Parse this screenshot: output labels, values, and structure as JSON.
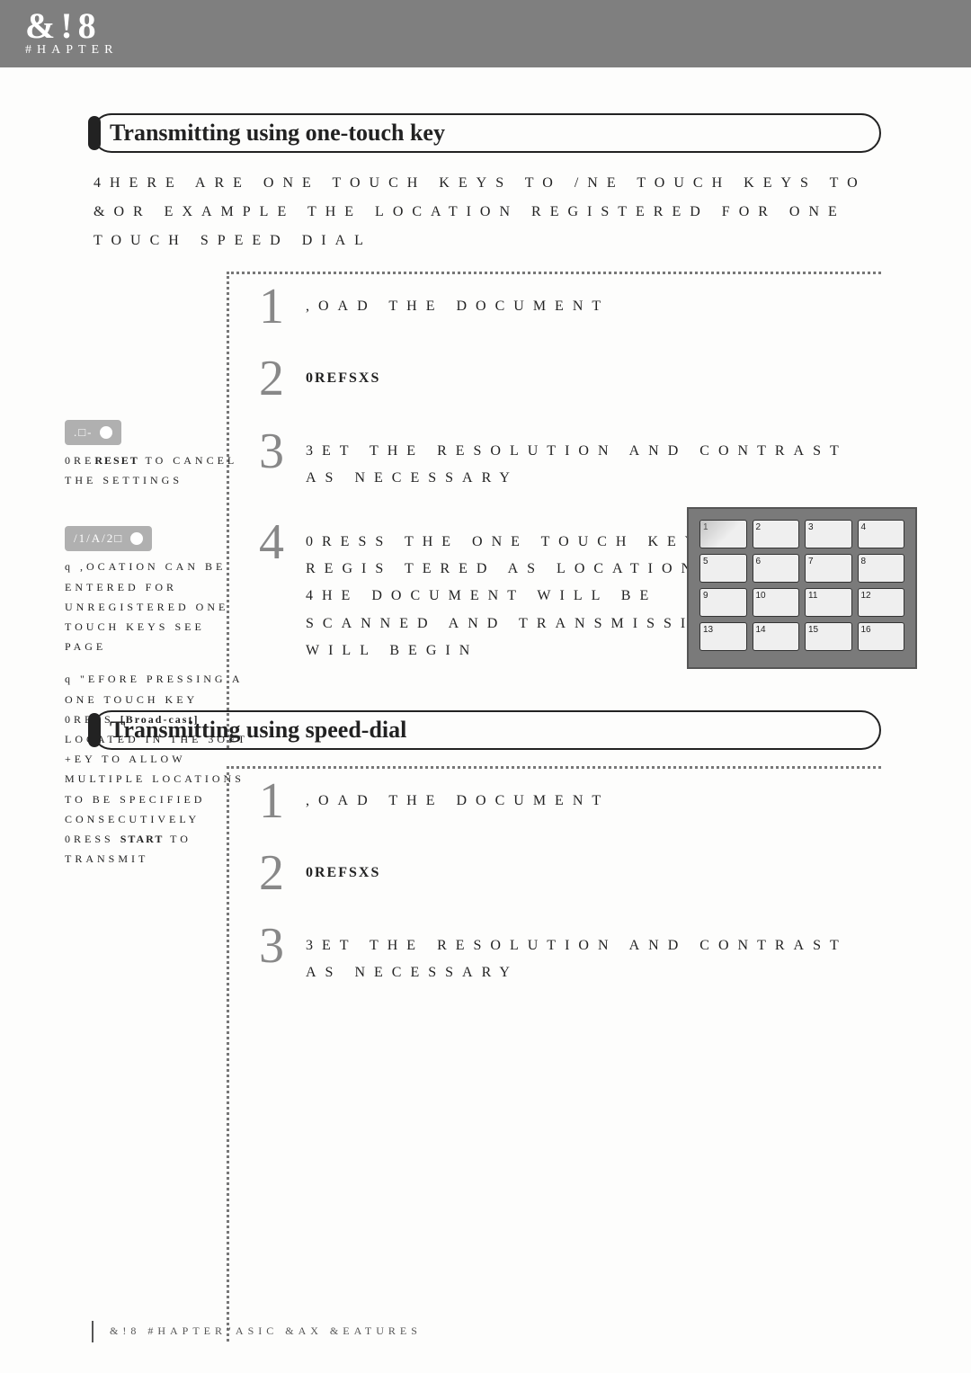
{
  "header": {
    "big": "&!8",
    "small": "#HAPTER"
  },
  "section1": {
    "title": "Transmitting using one-touch key",
    "intro": "4HERE ARE  ONE TOUCH KEYS  TO  /NE TOUCH KEYS  TO  &OR EXAMPLE THE LOCATION REGISTERED FOR ONE TOUCH SPEED DIAL",
    "steps": [
      {
        "n": "1",
        "t": ",OAD THE DOCUMENT"
      },
      {
        "n": "2",
        "t": "0REFSXS"
      },
      {
        "n": "3",
        "t": "3ET THE RESOLUTION AND CONTRAST AS NECESSARY"
      },
      {
        "n": "4",
        "t": "0RESS THE ONE TOUCH KEY REGIS TERED AS LOCATION  4HE DOCUMENT WILL BE SCANNED AND TRANSMISSION WILL BEGIN"
      }
    ],
    "noteA_pill": ".□-",
    "noteA": "0RESET TO CANCEL THE SETTINGS",
    "noteA_bold": "RESET",
    "noteB_pill": "/1/A/2□",
    "noteB1": "q ,OCATION CAN BE ENTERED FOR UNREGISTERED ONE TOUCH KEYS  SEE PAGE",
    "noteB2_a": "q \"EFORE PRESSING A ONE TOUCH KEY  0RESS ",
    "noteB2_bold1": "[Broad-cast]",
    "noteB2_b": " LOCATED IN THE 3OFT +EY TO ALLOW MULTIPLE LOCATIONS TO BE SPECIFIED CONSECUTIVELY  0RESS ",
    "noteB2_bold2": "START",
    "noteB2_c": " TO TRANSMIT"
  },
  "section2": {
    "title": "Transmitting using speed-dial",
    "steps": [
      {
        "n": "1",
        "t": ",OAD THE DOCUMENT"
      },
      {
        "n": "2",
        "t": "0REFSXS"
      },
      {
        "n": "3",
        "t": "3ET THE RESOLUTION AND CONTRAST AS NECESSARY"
      }
    ]
  },
  "keypad_labels": [
    "1",
    "2",
    "3",
    "4",
    "5",
    "6",
    "7",
    "8",
    "9",
    "10",
    "11",
    "12",
    "13",
    "14",
    "15",
    "16"
  ],
  "footer": "&!8 #HAPTER\"ASIC &AX &EATURES"
}
